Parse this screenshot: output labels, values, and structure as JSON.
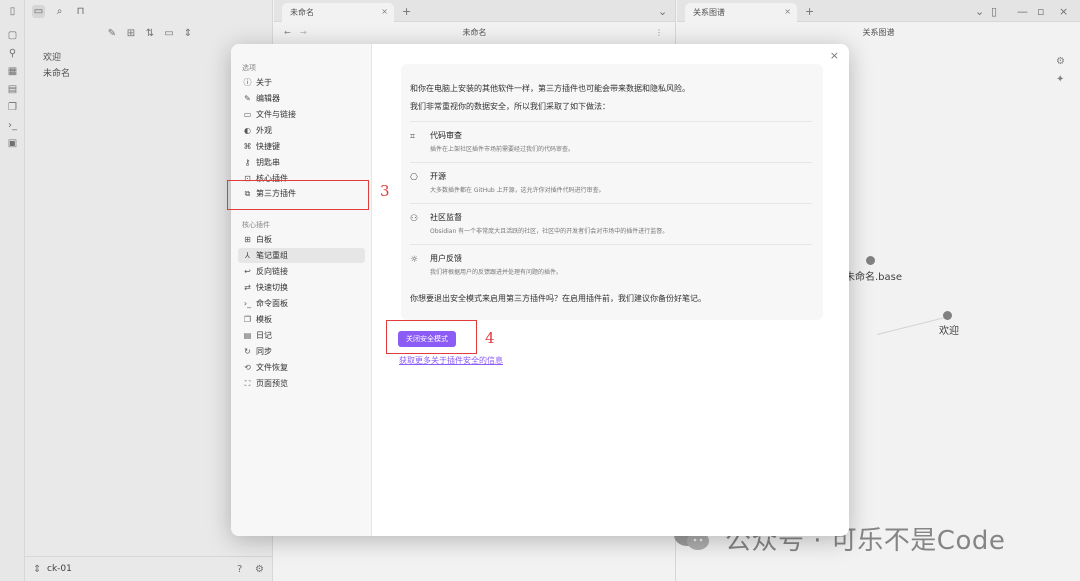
{
  "left_panel": {
    "files": [
      "欢迎",
      "未命名"
    ],
    "vault_name": "ck-01"
  },
  "mid_pane": {
    "tab_label": "未命名",
    "view_title": "未命名"
  },
  "right_pane": {
    "tab_label": "关系图谱",
    "view_title": "关系图谱",
    "nodes": [
      {
        "label": "未命名.base"
      },
      {
        "label": "欢迎"
      }
    ]
  },
  "modal": {
    "options_group": "选项",
    "options": [
      {
        "label": "关于",
        "icon": "info-icon"
      },
      {
        "label": "编辑器",
        "icon": "pencil-icon"
      },
      {
        "label": "文件与链接",
        "icon": "folder-icon"
      },
      {
        "label": "外观",
        "icon": "palette-icon"
      },
      {
        "label": "快捷键",
        "icon": "command-icon"
      },
      {
        "label": "钥匙串",
        "icon": "key-icon"
      },
      {
        "label": "核心插件",
        "icon": "plug-icon"
      },
      {
        "label": "第三方插件",
        "icon": "puzzle-icon"
      }
    ],
    "core_group": "核心插件",
    "core_plugins": [
      {
        "label": "白板",
        "icon": "canvas-icon"
      },
      {
        "label": "笔记重组",
        "icon": "merge-icon"
      },
      {
        "label": "反向链接",
        "icon": "backlink-icon"
      },
      {
        "label": "快速切换",
        "icon": "switch-icon"
      },
      {
        "label": "命令面板",
        "icon": "terminal-icon"
      },
      {
        "label": "模板",
        "icon": "template-icon"
      },
      {
        "label": "日记",
        "icon": "calendar-icon"
      },
      {
        "label": "同步",
        "icon": "sync-icon"
      },
      {
        "label": "文件恢复",
        "icon": "history-icon"
      },
      {
        "label": "页面预览",
        "icon": "preview-icon"
      }
    ],
    "intro_1": "和你在电脑上安装的其他软件一样，第三方插件也可能会带来数据和隐私风险。",
    "intro_2": "我们非常重视你的数据安全，所以我们采取了如下做法：",
    "features": [
      {
        "title": "代码审查",
        "desc": "插件在上架社区插件市场前需要经过我们的代码审查。",
        "icon": "review-icon"
      },
      {
        "title": "开源",
        "desc": "大多数插件都在 GitHub 上开源，这允许你对插件代码进行审查。",
        "icon": "github-icon"
      },
      {
        "title": "社区监督",
        "desc": "Obsidian 有一个非常庞大且活跃的社区，社区中的开发者们会对市场中的插件进行监督。",
        "icon": "users-icon"
      },
      {
        "title": "用户反馈",
        "desc": "我们将根据用户的反馈跟进并处理有问题的插件。",
        "icon": "bug-icon"
      }
    ],
    "question": "你想要退出安全模式来启用第三方插件吗？在启用插件前，我们建议你备份好笔记。",
    "primary_button": "关闭安全模式",
    "link_text": "获取更多关于插件安全的信息"
  },
  "annotations": {
    "step3": "3",
    "step4": "4"
  },
  "watermark": "公众号 · 可乐不是Code",
  "colors": {
    "accent": "#8b5cf6",
    "annotation": "#e23b3b"
  }
}
